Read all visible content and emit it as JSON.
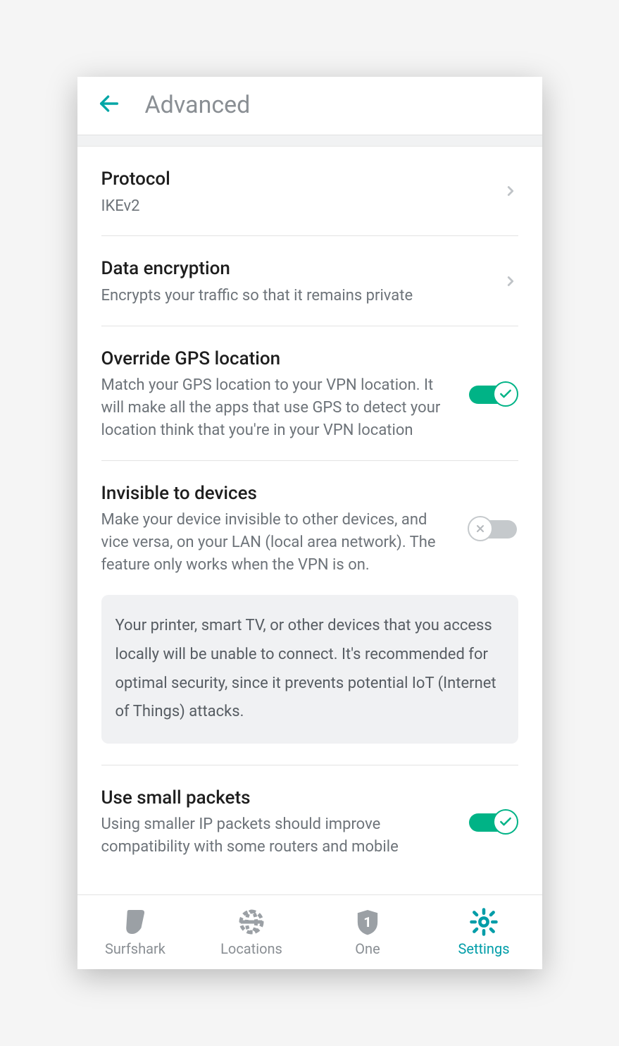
{
  "header": {
    "title": "Advanced"
  },
  "settings": {
    "protocol": {
      "title": "Protocol",
      "value": "IKEv2"
    },
    "encryption": {
      "title": "Data encryption",
      "desc": "Encrypts your traffic so that it remains private"
    },
    "gps": {
      "title": "Override GPS location",
      "desc": "Match your GPS location to your VPN location. It will make all the apps that use GPS to detect your location think that you're in your VPN location",
      "on": true
    },
    "invisible": {
      "title": "Invisible to devices",
      "desc": "Make your device invisible to other devices, and vice versa, on your LAN (local area network). The feature only works when the VPN is on.",
      "on": false,
      "info": "Your printer, smart TV, or other devices that you access locally will be unable to connect. It's recommended for optimal security, since it prevents potential IoT (Internet of Things) attacks."
    },
    "small_packets": {
      "title": "Use small packets",
      "desc": "Using smaller IP packets should improve compatibility with some routers and mobile",
      "on": true
    }
  },
  "nav": {
    "surfshark": "Surfshark",
    "locations": "Locations",
    "one": "One",
    "settings": "Settings"
  }
}
